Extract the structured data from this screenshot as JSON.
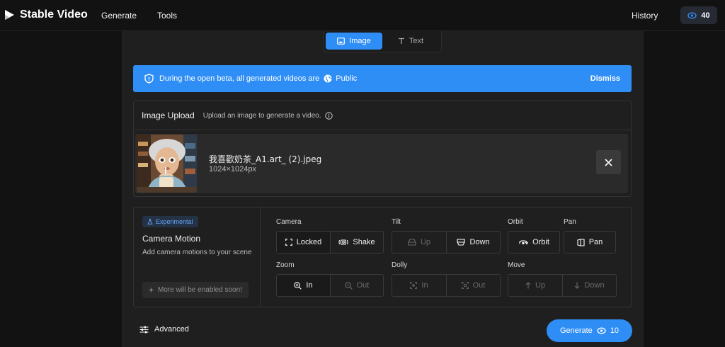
{
  "app": {
    "name": "Stable Video"
  },
  "nav": {
    "generate": "Generate",
    "tools": "Tools",
    "history": "History",
    "credits": "40"
  },
  "mode": {
    "image": "Image",
    "text": "Text",
    "selected": "Image"
  },
  "banner": {
    "message": "During the open beta, all generated videos are",
    "visibility": "Public",
    "dismiss": "Dismiss"
  },
  "upload": {
    "title": "Image Upload",
    "subtitle": "Upload an image to generate a video.",
    "file": {
      "name": "我喜歡奶茶_A1.art_ (2).jpeg",
      "dimensions": "1024×1024px"
    }
  },
  "motion": {
    "badge": "Experimental",
    "title": "Camera Motion",
    "description": "Add camera motions to your scene",
    "notice": "More will be enabled soon!",
    "camera": {
      "label": "Camera",
      "locked": "Locked",
      "shake": "Shake"
    },
    "tilt": {
      "label": "Tilt",
      "up": "Up",
      "down": "Down"
    },
    "orbit": {
      "label": "Orbit",
      "orbit": "Orbit"
    },
    "pan": {
      "label": "Pan",
      "pan": "Pan"
    },
    "zoom": {
      "label": "Zoom",
      "in": "In",
      "out": "Out"
    },
    "dolly": {
      "label": "Dolly",
      "in": "In",
      "out": "Out"
    },
    "move": {
      "label": "Move",
      "up": "Up",
      "down": "Down"
    }
  },
  "footer": {
    "advanced": "Advanced",
    "generate": "Generate",
    "cost": "10"
  },
  "colors": {
    "accent": "#2f8ef6",
    "background": "#121212",
    "panel": "#1f1f1f"
  }
}
